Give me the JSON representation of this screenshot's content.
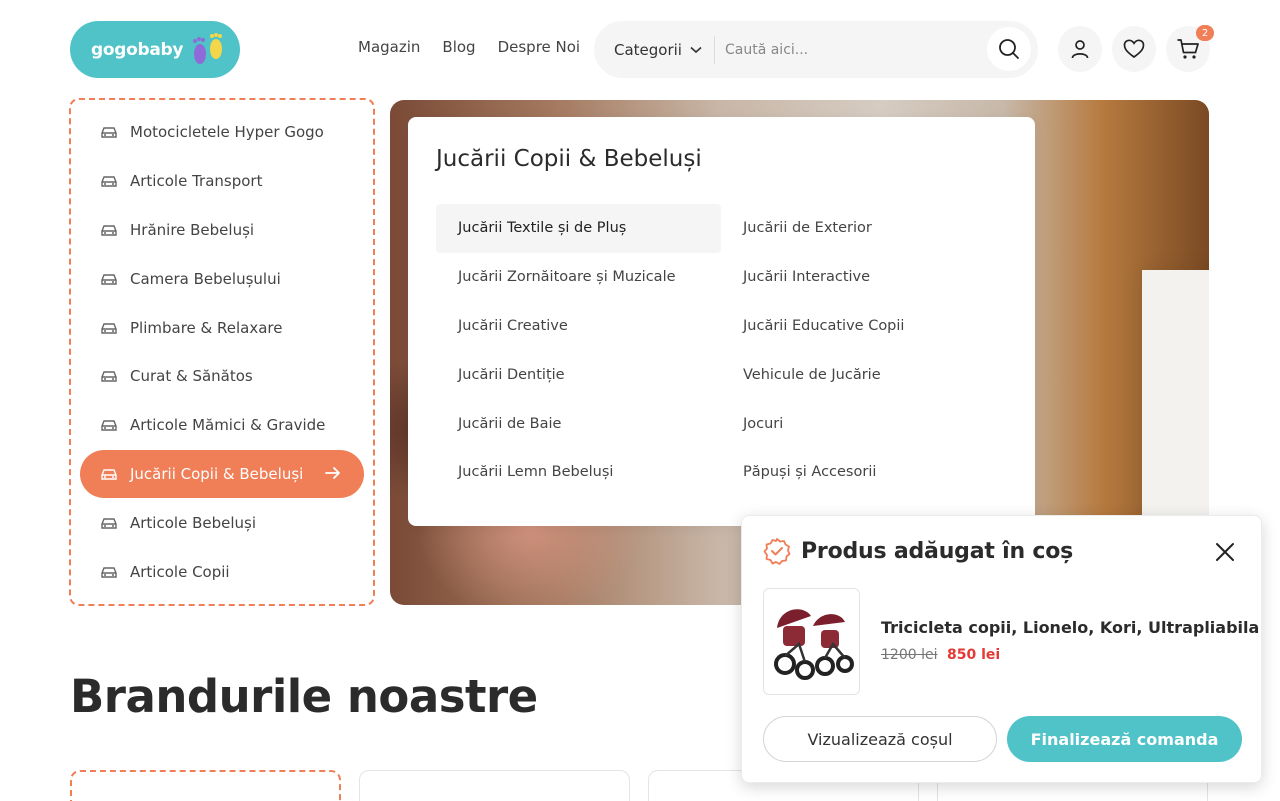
{
  "header": {
    "logo_text": "gogobaby",
    "nav": [
      "Magazin",
      "Blog",
      "Despre Noi"
    ],
    "category_select": "Categorii",
    "search_placeholder": "Caută aici...",
    "cart_count": "2",
    "icons": [
      "search-icon",
      "user-icon",
      "heart-icon",
      "cart-icon"
    ]
  },
  "sidebar": {
    "items": [
      {
        "label": "Motocicletele Hyper Gogo"
      },
      {
        "label": "Articole Transport"
      },
      {
        "label": "Hrănire Bebeluși"
      },
      {
        "label": "Camera Bebelușului"
      },
      {
        "label": "Plimbare & Relaxare"
      },
      {
        "label": "Curat & Sănătos"
      },
      {
        "label": "Articole Mămici & Gravide"
      },
      {
        "label": "Jucării Copii & Bebeluși",
        "active": true
      },
      {
        "label": "Articole Bebeluși"
      },
      {
        "label": "Articole Copii"
      }
    ]
  },
  "mega_menu": {
    "title": "Jucării Copii & Bebeluși",
    "col1": [
      "Jucării Textile și de Pluș",
      "Jucării Zornăitoare și Muzicale",
      "Jucării Creative",
      "Jucării Dentiție",
      "Jucării de Baie",
      "Jucării Lemn Bebeluși"
    ],
    "col2": [
      "Jucării de Exterior",
      "Jucării Interactive",
      "Jucării Educative Copii",
      "Vehicule de Jucărie",
      "Jocuri",
      "Păpuși și Accesorii"
    ]
  },
  "brands": {
    "title": "Brandurile noastre"
  },
  "cart_popup": {
    "title": "Produs adăugat în coș",
    "product_name": "Tricicleta copii, Lionelo, Kori, Ultrapliabila",
    "old_price": "1200 lei",
    "new_price": "850 lei",
    "view_cart": "Vizualizează coșul",
    "checkout": "Finalizează comanda"
  },
  "colors": {
    "accent": "#f07e57",
    "brand": "#4fc3c7",
    "sale": "#e53935"
  }
}
